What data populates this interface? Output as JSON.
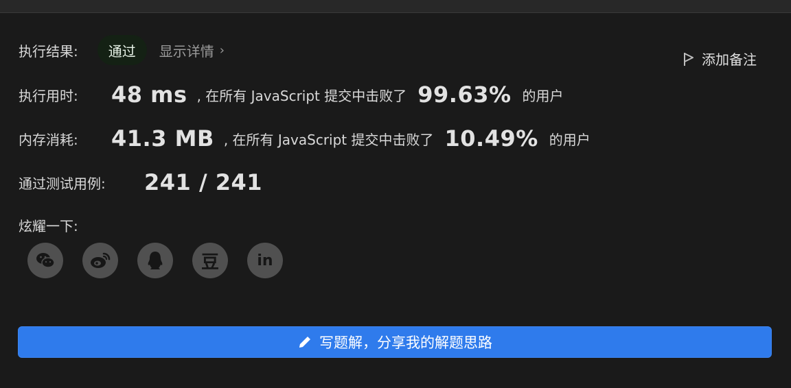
{
  "result": {
    "label": "执行结果:",
    "status_badge": "通过",
    "details_link": "显示详情",
    "chevron": "›",
    "add_note": "添加备注"
  },
  "runtime": {
    "label": "执行用时:",
    "value": "48 ms",
    "mid_text": ", 在所有 JavaScript 提交中击败了",
    "percent": "99.63%",
    "suffix": "的用户"
  },
  "memory": {
    "label": "内存消耗:",
    "value": "41.3 MB",
    "mid_text": ", 在所有 JavaScript 提交中击败了",
    "percent": "10.49%",
    "suffix": "的用户"
  },
  "testcases": {
    "label": "通过测试用例:",
    "value": "241 / 241"
  },
  "share": {
    "label": "炫耀一下:",
    "icons": [
      "wechat-icon",
      "weibo-icon",
      "qq-icon",
      "douban-icon",
      "linkedin-icon"
    ],
    "douban_glyph": "豆",
    "linkedin_glyph": "in"
  },
  "cta": {
    "label": "写题解，分享我的解题思路"
  },
  "colors": {
    "background": "#1a1a1a",
    "badge_bg": "#142114",
    "primary": "#2f7bec",
    "icon_circle": "#505050"
  }
}
